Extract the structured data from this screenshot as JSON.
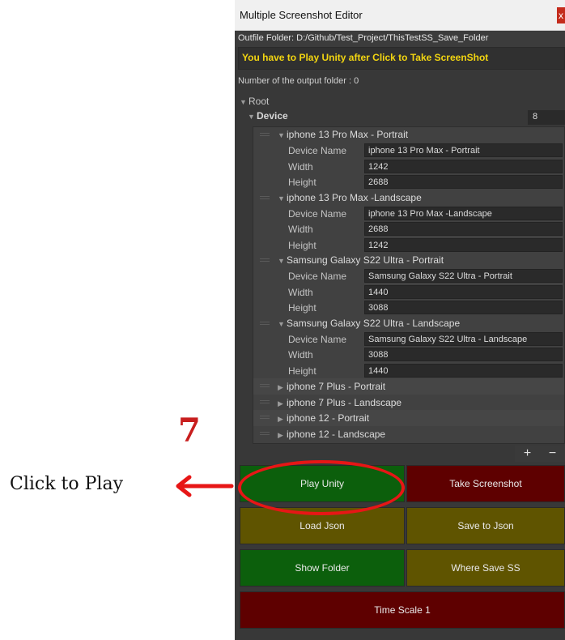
{
  "window": {
    "title": "Multiple Screenshot Editor",
    "close_glyph": "x"
  },
  "outfile_folder": "Outfile Folder: D:/Github/Test_Project/ThisTestSS_Save_Folder",
  "warning": "You have to Play Unity after Click to Take ScreenShot",
  "output_folder_count": "Number of the output folder : 0",
  "tree": {
    "root_label": "Root",
    "device_label": "Device",
    "device_count": "8",
    "expanded_devices": [
      {
        "header": "iphone 13 Pro Max - Portrait",
        "fields": {
          "device_name_label": "Device Name",
          "device_name": "iphone 13 Pro Max - Portrait",
          "width_label": "Width",
          "width": "1242",
          "height_label": "Height",
          "height": "2688"
        }
      },
      {
        "header": "iphone 13 Pro Max -Landscape",
        "fields": {
          "device_name_label": "Device Name",
          "device_name": "iphone 13 Pro Max -Landscape",
          "width_label": "Width",
          "width": "2688",
          "height_label": "Height",
          "height": "1242"
        }
      },
      {
        "header": "Samsung Galaxy S22 Ultra - Portrait",
        "fields": {
          "device_name_label": "Device Name",
          "device_name": "Samsung Galaxy S22 Ultra - Portrait",
          "width_label": "Width",
          "width": "1440",
          "height_label": "Height",
          "height": "3088"
        }
      },
      {
        "header": "Samsung Galaxy S22 Ultra - Landscape",
        "fields": {
          "device_name_label": "Device Name",
          "device_name": "Samsung Galaxy S22 Ultra - Landscape",
          "width_label": "Width",
          "width": "3088",
          "height_label": "Height",
          "height": "1440"
        }
      }
    ],
    "collapsed_devices": [
      "iphone 7 Plus - Portrait",
      "iphone 7 Plus - Landscape",
      "iphone 12 - Portrait",
      "iphone 12 - Landscape"
    ],
    "add_glyph": "+",
    "remove_glyph": "−"
  },
  "buttons": {
    "play_unity": "Play Unity",
    "take_screenshot": "Take Screenshot",
    "load_json": "Load Json",
    "save_to_json": "Save to Json",
    "show_folder": "Show Folder",
    "where_save_ss": "Where Save SS",
    "time_scale": "Time Scale 1"
  },
  "annotation": {
    "step_number": "7",
    "text": "Click to Play"
  },
  "colors": {
    "green_button": "#0c5f0c",
    "red_button": "#5e0000",
    "olive_button": "#5f5400",
    "warning_text": "#f2d511",
    "highlight": "#e71616"
  }
}
